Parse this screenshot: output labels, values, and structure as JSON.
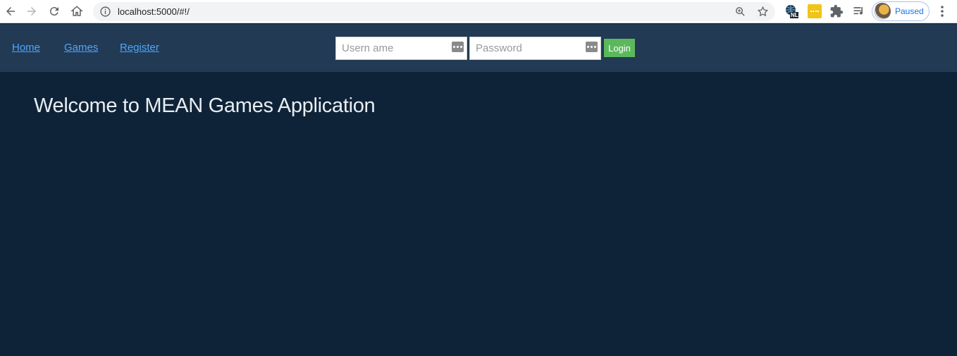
{
  "browser": {
    "url": "localhost:5000/#!/",
    "profile_status": "Paused",
    "extension_badge": "NL"
  },
  "nav": {
    "links": [
      "Home",
      "Games",
      "Register"
    ]
  },
  "login": {
    "username_placeholder": "Usern ame",
    "password_placeholder": "Password",
    "button_label": "Login"
  },
  "main": {
    "title": "Welcome to MEAN Games Application"
  },
  "colors": {
    "header_bg": "#223a53",
    "page_bg": "#0f2338",
    "link": "#4da6ff",
    "login_button": "#5cb85c"
  }
}
